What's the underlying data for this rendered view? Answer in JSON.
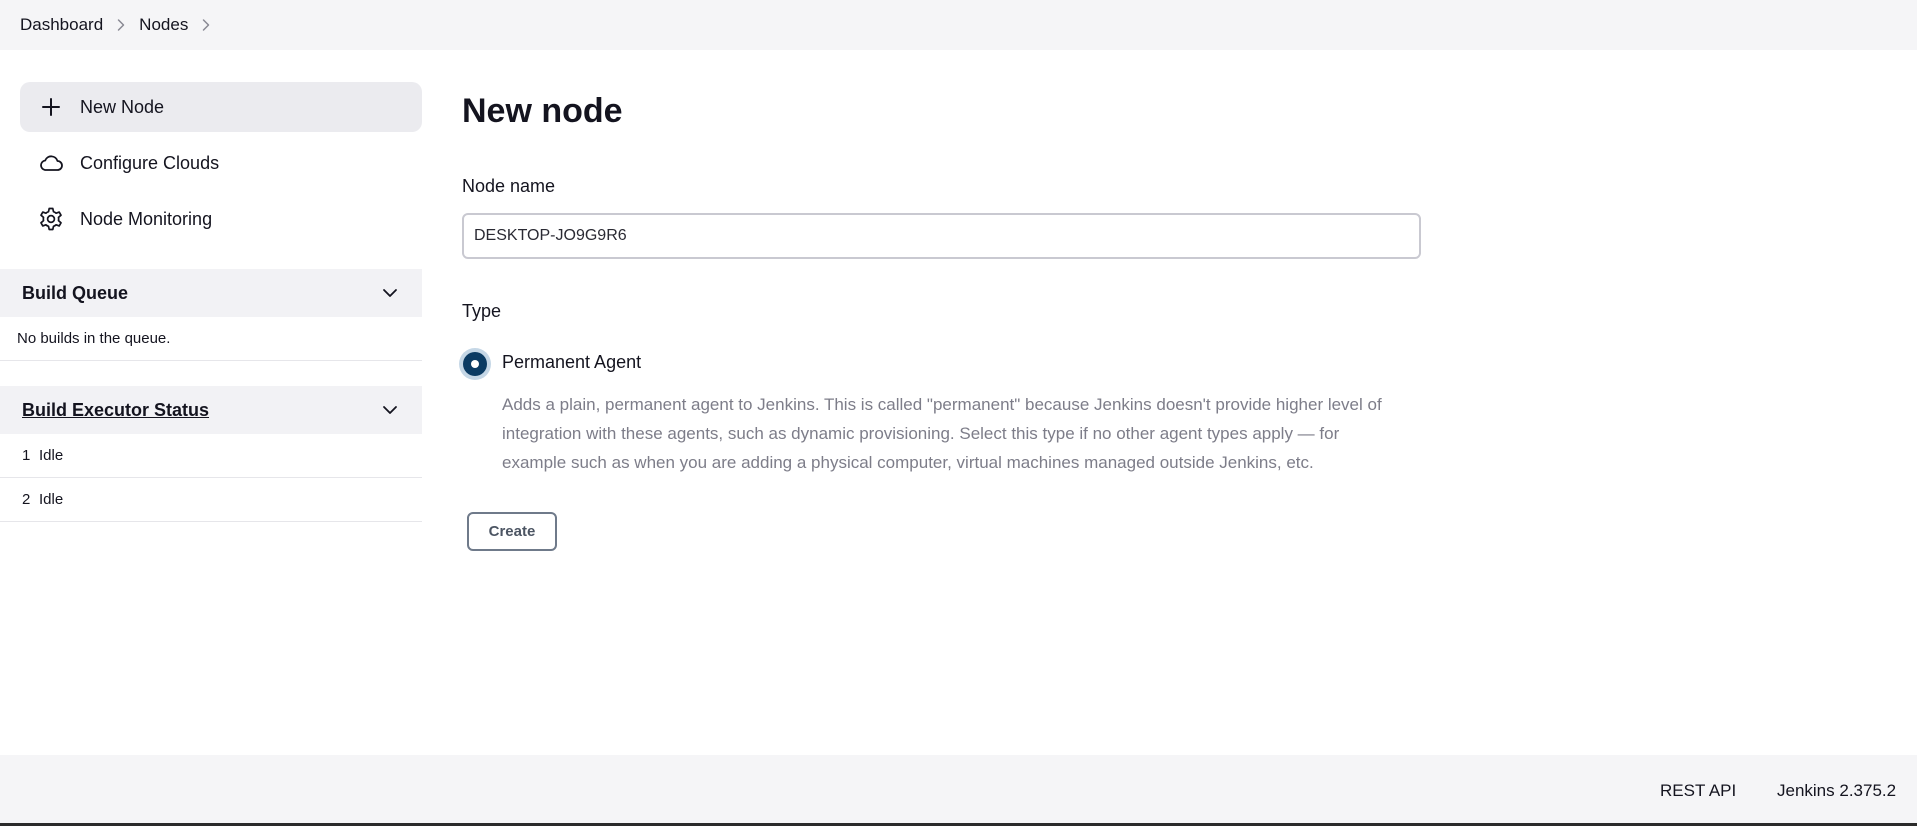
{
  "breadcrumb": {
    "items": [
      {
        "label": "Dashboard",
        "icon": "chevron-right-icon"
      },
      {
        "label": "Nodes",
        "icon": "chevron-right-icon"
      }
    ]
  },
  "sidebar": {
    "tasks": [
      {
        "label": "New Node",
        "icon": "plus-icon"
      },
      {
        "label": "Configure Clouds",
        "icon": "cloud-icon"
      },
      {
        "label": "Node Monitoring",
        "icon": "gear-icon"
      }
    ]
  },
  "build_queue": {
    "title": "Build Queue",
    "empty_message": "No builds in the queue."
  },
  "executor_status": {
    "title": "Build Executor Status",
    "executors": [
      {
        "number": "1",
        "status": "Idle"
      },
      {
        "number": "2",
        "status": "Idle"
      }
    ]
  },
  "main": {
    "title": "New node",
    "node_name_label": "Node name",
    "node_name_value": "DESKTOP-JO9G9R6",
    "type_label": "Type",
    "type_option": {
      "label": "Permanent Agent",
      "selected": true,
      "description": "Adds a plain, permanent agent to Jenkins. This is called \"permanent\" because Jenkins doesn't provide higher level of integration with these agents, such as dynamic provisioning. Select this type if no other agent types apply — for example such as when you are adding a physical computer, virtual machines managed outside Jenkins, etc."
    },
    "create_label": "Create"
  },
  "footer": {
    "rest_api": "REST API",
    "version": "Jenkins 2.375.2"
  },
  "colors": {
    "radio_selected": "#0b3b63",
    "header_bg": "#f5f5f7",
    "active_task_bg": "#ebebef"
  }
}
